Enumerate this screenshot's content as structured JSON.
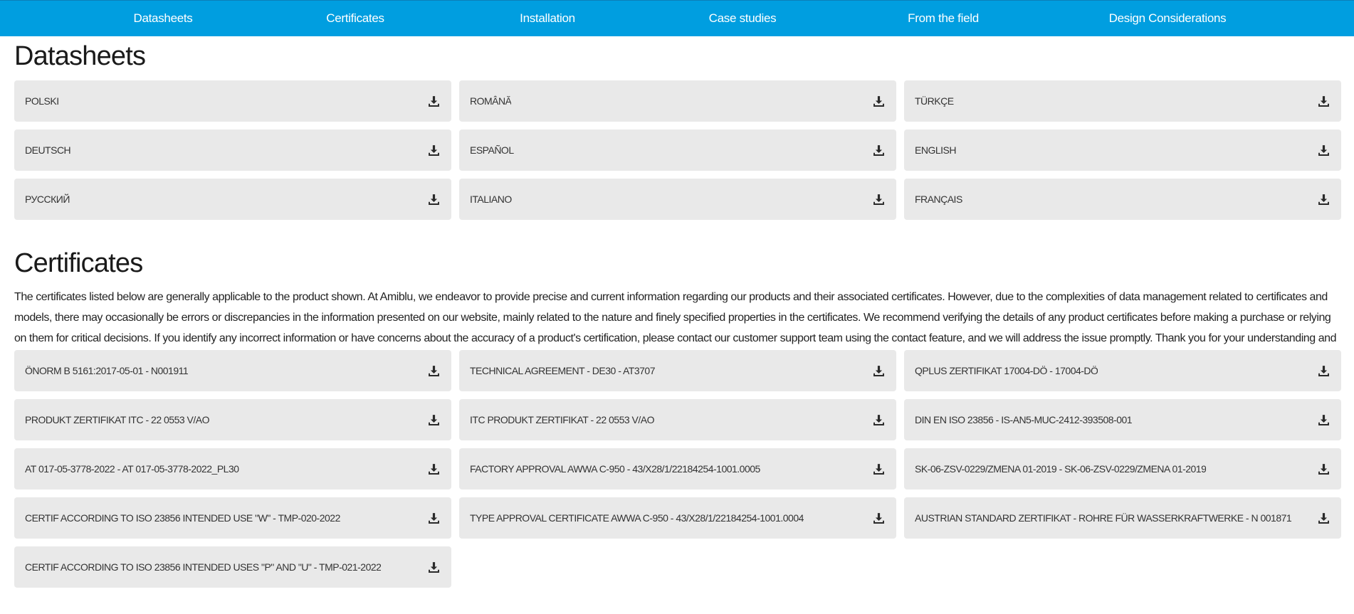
{
  "nav": [
    {
      "label": "Datasheets"
    },
    {
      "label": "Certificates"
    },
    {
      "label": "Installation"
    },
    {
      "label": "Case studies"
    },
    {
      "label": "From the field"
    },
    {
      "label": "Design Considerations"
    }
  ],
  "datasheets": {
    "title": "Datasheets",
    "items": [
      {
        "label": "POLSKI"
      },
      {
        "label": "ROMÂNĂ"
      },
      {
        "label": "TÜRKÇE"
      },
      {
        "label": "DEUTSCH"
      },
      {
        "label": "ESPAÑOL"
      },
      {
        "label": "ENGLISH"
      },
      {
        "label": "РУССКИЙ"
      },
      {
        "label": "ITALIANO"
      },
      {
        "label": "FRANÇAIS"
      }
    ]
  },
  "certificates": {
    "title": "Certificates",
    "intro": "The certificates listed below are generally applicable to the product shown. At Amiblu, we endeavor to provide precise and current information regarding our products and their associated certificates. However, due to the complexities of data management related to certificates and models, there may occasionally be errors or discrepancies in the information presented on our website, mainly related to the nature and finely specified properties in the certificates. We recommend verifying the details of any product certificates before making a purchase or relying on them for critical decisions. If you identify any incorrect information or have concerns about the accuracy of a product's certification, please contact our customer support team using the contact feature, and we will address the issue promptly. Thank you for your understanding and continued trust in Amiblu.",
    "items": [
      {
        "label": "ÖNORM B 5161:2017-05-01 - N001911"
      },
      {
        "label": "TECHNICAL AGREEMENT - DE30 - AT3707"
      },
      {
        "label": "QPLUS ZERTIFIKAT 17004-DÖ - 17004-DÖ"
      },
      {
        "label": "PRODUKT ZERTIFIKAT ITC - 22 0553 V/AO"
      },
      {
        "label": "ITC PRODUKT ZERTIFIKAT - 22 0553 V/AO"
      },
      {
        "label": "DIN EN ISO 23856 - IS-AN5-MUC-2412-393508-001"
      },
      {
        "label": "AT 017-05-3778-2022 - AT 017-05-3778-2022_PL30"
      },
      {
        "label": "FACTORY APPROVAL AWWA C-950 - 43/X28/1/22184254-1001.0005"
      },
      {
        "label": "SK-06-ZSV-0229/ZMENA 01-2019 - SK-06-ZSV-0229/ZMENA 01-2019"
      },
      {
        "label": "CERTIF ACCORDING TO ISO 23856 INTENDED USE \"W\" - TMP-020-2022"
      },
      {
        "label": "TYPE APPROVAL CERTIFICATE AWWA C-950 - 43/X28/1/22184254-1001.0004"
      },
      {
        "label": "AUSTRIAN STANDARD ZERTIFIKAT - ROHRE FÜR WASSERKRAFTWERKE - N 001871"
      },
      {
        "label": "CERTIF ACCORDING TO ISO 23856 INTENDED USES \"P\" AND \"U\" - TMP-021-2022"
      }
    ]
  },
  "icons": {
    "download": "download-icon"
  },
  "colors": {
    "nav_bg": "#009ee0",
    "item_bg": "#e9e9e9"
  }
}
